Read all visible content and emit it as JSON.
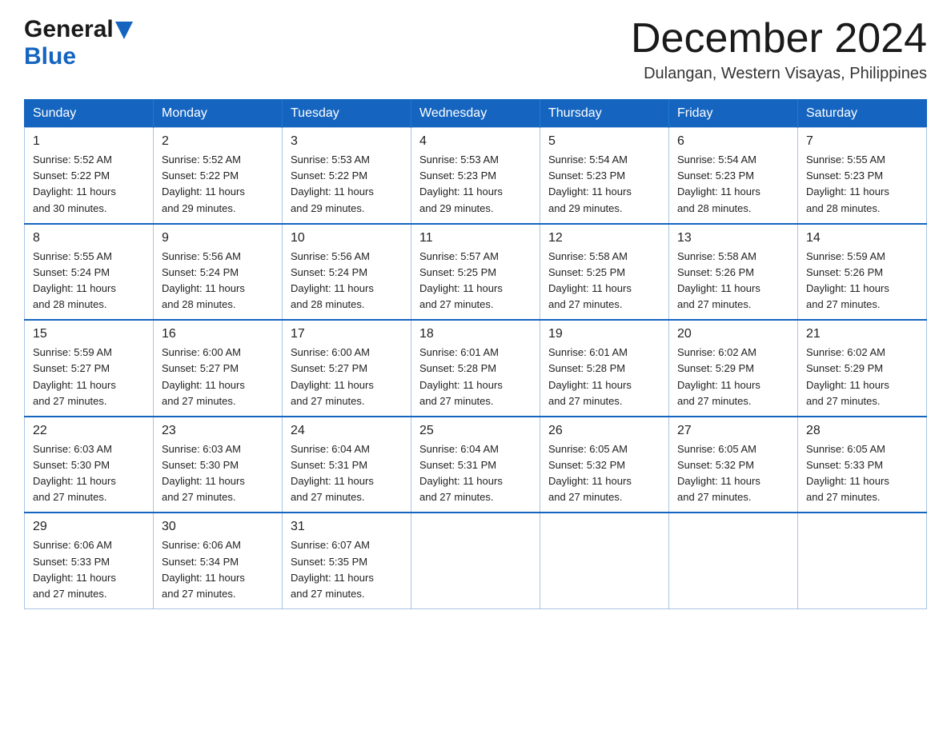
{
  "header": {
    "logo_general": "General",
    "logo_blue": "Blue",
    "month_title": "December 2024",
    "location": "Dulangan, Western Visayas, Philippines"
  },
  "weekdays": [
    "Sunday",
    "Monday",
    "Tuesday",
    "Wednesday",
    "Thursday",
    "Friday",
    "Saturday"
  ],
  "weeks": [
    [
      {
        "day": "1",
        "sunrise": "5:52 AM",
        "sunset": "5:22 PM",
        "daylight": "11 hours and 30 minutes."
      },
      {
        "day": "2",
        "sunrise": "5:52 AM",
        "sunset": "5:22 PM",
        "daylight": "11 hours and 29 minutes."
      },
      {
        "day": "3",
        "sunrise": "5:53 AM",
        "sunset": "5:22 PM",
        "daylight": "11 hours and 29 minutes."
      },
      {
        "day": "4",
        "sunrise": "5:53 AM",
        "sunset": "5:23 PM",
        "daylight": "11 hours and 29 minutes."
      },
      {
        "day": "5",
        "sunrise": "5:54 AM",
        "sunset": "5:23 PM",
        "daylight": "11 hours and 29 minutes."
      },
      {
        "day": "6",
        "sunrise": "5:54 AM",
        "sunset": "5:23 PM",
        "daylight": "11 hours and 28 minutes."
      },
      {
        "day": "7",
        "sunrise": "5:55 AM",
        "sunset": "5:23 PM",
        "daylight": "11 hours and 28 minutes."
      }
    ],
    [
      {
        "day": "8",
        "sunrise": "5:55 AM",
        "sunset": "5:24 PM",
        "daylight": "11 hours and 28 minutes."
      },
      {
        "day": "9",
        "sunrise": "5:56 AM",
        "sunset": "5:24 PM",
        "daylight": "11 hours and 28 minutes."
      },
      {
        "day": "10",
        "sunrise": "5:56 AM",
        "sunset": "5:24 PM",
        "daylight": "11 hours and 28 minutes."
      },
      {
        "day": "11",
        "sunrise": "5:57 AM",
        "sunset": "5:25 PM",
        "daylight": "11 hours and 27 minutes."
      },
      {
        "day": "12",
        "sunrise": "5:58 AM",
        "sunset": "5:25 PM",
        "daylight": "11 hours and 27 minutes."
      },
      {
        "day": "13",
        "sunrise": "5:58 AM",
        "sunset": "5:26 PM",
        "daylight": "11 hours and 27 minutes."
      },
      {
        "day": "14",
        "sunrise": "5:59 AM",
        "sunset": "5:26 PM",
        "daylight": "11 hours and 27 minutes."
      }
    ],
    [
      {
        "day": "15",
        "sunrise": "5:59 AM",
        "sunset": "5:27 PM",
        "daylight": "11 hours and 27 minutes."
      },
      {
        "day": "16",
        "sunrise": "6:00 AM",
        "sunset": "5:27 PM",
        "daylight": "11 hours and 27 minutes."
      },
      {
        "day": "17",
        "sunrise": "6:00 AM",
        "sunset": "5:27 PM",
        "daylight": "11 hours and 27 minutes."
      },
      {
        "day": "18",
        "sunrise": "6:01 AM",
        "sunset": "5:28 PM",
        "daylight": "11 hours and 27 minutes."
      },
      {
        "day": "19",
        "sunrise": "6:01 AM",
        "sunset": "5:28 PM",
        "daylight": "11 hours and 27 minutes."
      },
      {
        "day": "20",
        "sunrise": "6:02 AM",
        "sunset": "5:29 PM",
        "daylight": "11 hours and 27 minutes."
      },
      {
        "day": "21",
        "sunrise": "6:02 AM",
        "sunset": "5:29 PM",
        "daylight": "11 hours and 27 minutes."
      }
    ],
    [
      {
        "day": "22",
        "sunrise": "6:03 AM",
        "sunset": "5:30 PM",
        "daylight": "11 hours and 27 minutes."
      },
      {
        "day": "23",
        "sunrise": "6:03 AM",
        "sunset": "5:30 PM",
        "daylight": "11 hours and 27 minutes."
      },
      {
        "day": "24",
        "sunrise": "6:04 AM",
        "sunset": "5:31 PM",
        "daylight": "11 hours and 27 minutes."
      },
      {
        "day": "25",
        "sunrise": "6:04 AM",
        "sunset": "5:31 PM",
        "daylight": "11 hours and 27 minutes."
      },
      {
        "day": "26",
        "sunrise": "6:05 AM",
        "sunset": "5:32 PM",
        "daylight": "11 hours and 27 minutes."
      },
      {
        "day": "27",
        "sunrise": "6:05 AM",
        "sunset": "5:32 PM",
        "daylight": "11 hours and 27 minutes."
      },
      {
        "day": "28",
        "sunrise": "6:05 AM",
        "sunset": "5:33 PM",
        "daylight": "11 hours and 27 minutes."
      }
    ],
    [
      {
        "day": "29",
        "sunrise": "6:06 AM",
        "sunset": "5:33 PM",
        "daylight": "11 hours and 27 minutes."
      },
      {
        "day": "30",
        "sunrise": "6:06 AM",
        "sunset": "5:34 PM",
        "daylight": "11 hours and 27 minutes."
      },
      {
        "day": "31",
        "sunrise": "6:07 AM",
        "sunset": "5:35 PM",
        "daylight": "11 hours and 27 minutes."
      },
      null,
      null,
      null,
      null
    ]
  ],
  "labels": {
    "sunrise": "Sunrise:",
    "sunset": "Sunset:",
    "daylight": "Daylight:"
  }
}
